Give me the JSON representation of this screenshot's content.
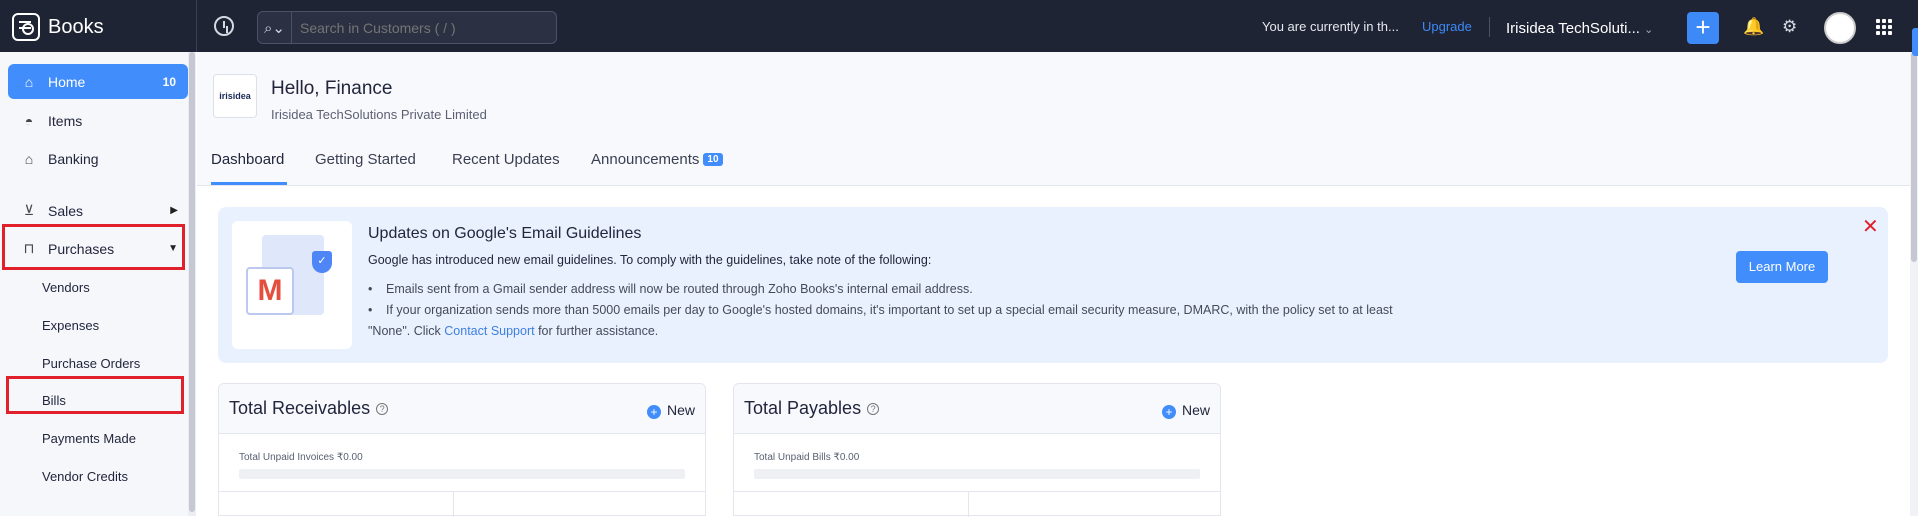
{
  "app": {
    "name": "Books"
  },
  "topbar": {
    "search_placeholder": "Search in Customers ( / )",
    "trial_text": "You are currently in th...",
    "upgrade_label": "Upgrade",
    "org_label": "Irisidea TechSoluti...",
    "org_caret": "⌄",
    "plus_label": "+",
    "bell_icon": "🔔",
    "gear_icon": "⚙"
  },
  "sidebar": {
    "home": {
      "label": "Home",
      "badge": "10"
    },
    "items": [
      {
        "label": "Items"
      },
      {
        "label": "Banking"
      },
      {
        "label": "Sales"
      },
      {
        "label": "Purchases"
      }
    ],
    "purchases_sub": [
      "Vendors",
      "Expenses",
      "Purchase Orders",
      "Bills",
      "Payments Made",
      "Vendor Credits"
    ]
  },
  "header": {
    "org_logo_text": "irisidea",
    "greeting": "Hello, Finance",
    "org_full_name": "Irisidea TechSolutions Private Limited",
    "tabs": [
      {
        "label": "Dashboard",
        "active": true
      },
      {
        "label": "Getting Started"
      },
      {
        "label": "Recent Updates"
      },
      {
        "label": "Announcements",
        "badge": "10"
      }
    ]
  },
  "banner": {
    "title": "Updates on Google's Email Guidelines",
    "description": "Google has introduced new email guidelines. To comply with the guidelines, take note of the following:",
    "bullet1": "Emails sent from a Gmail sender address will now be routed through Zoho Books's internal email address.",
    "bullet2": "If your organization sends more than 5000 emails per day to Google's hosted domains, it's important to set up a special email security measure, DMARC, with the policy set to at least",
    "bullet2_cont_pre": "\"None\". Click ",
    "bullet2_link": "Contact Support",
    "bullet2_cont_post": " for further assistance.",
    "learn_more": "Learn More",
    "close_symbol": "✕"
  },
  "cards": {
    "receivables": {
      "title": "Total Receivables",
      "new_label": "New",
      "sub": "Total Unpaid Invoices ₹0.00"
    },
    "payables": {
      "title": "Total Payables",
      "new_label": "New",
      "sub": "Total Unpaid Bills ₹0.00"
    }
  },
  "colors": {
    "accent": "#408dfb",
    "topbar": "#1f2434",
    "highlight": "#e0202a"
  }
}
